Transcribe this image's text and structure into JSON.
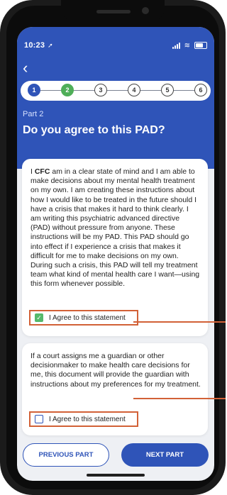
{
  "status_bar": {
    "time": "10:23"
  },
  "progress_steps": [
    {
      "label": "1",
      "state": "done"
    },
    {
      "label": "2",
      "state": "current"
    },
    {
      "label": "3",
      "state": "todo"
    },
    {
      "label": "4",
      "state": "todo"
    },
    {
      "label": "5",
      "state": "todo"
    },
    {
      "label": "6",
      "state": "todo"
    }
  ],
  "header": {
    "part": "Part 2",
    "title": "Do you agree to this PAD?"
  },
  "statement_1": {
    "prefix": "I ",
    "name": "CFC",
    "body": " am in a clear state of mind and I am able to make decisions about my mental health treatment on my own. I am creating these instructions about how I would like to be treated in the future should I have a crisis that makes it hard to think clearly. I am writing this psychiatric advanced directive (PAD) without pressure from anyone. These instructions will be my PAD. This PAD should go into effect if I experience a crisis that makes it difficult for me to make decisions on my own. During such a crisis, this PAD will tell my treatment team what kind of mental health care I want—using this form whenever possible.",
    "agree_label": "I Agree to this statement",
    "checked": true
  },
  "statement_2": {
    "body": "If a court assigns me a guardian or other decisionmaker to make health care decisions for me, this document will provide the guardian with instructions about my preferences for my treatment.",
    "agree_label": "I Agree to this statement",
    "checked": false
  },
  "buttons": {
    "previous": "PREVIOUS PART",
    "next": "NEXT PART"
  },
  "colors": {
    "primary": "#2f54b8",
    "current_step": "#4fae58",
    "checkbox_checked": "#55b96b",
    "callout": "#d26137"
  },
  "icons": {
    "back": "chevron-left-icon",
    "location": "location-arrow-icon",
    "wifi": "wifi-icon",
    "battery": "battery-icon",
    "check": "check-icon"
  }
}
